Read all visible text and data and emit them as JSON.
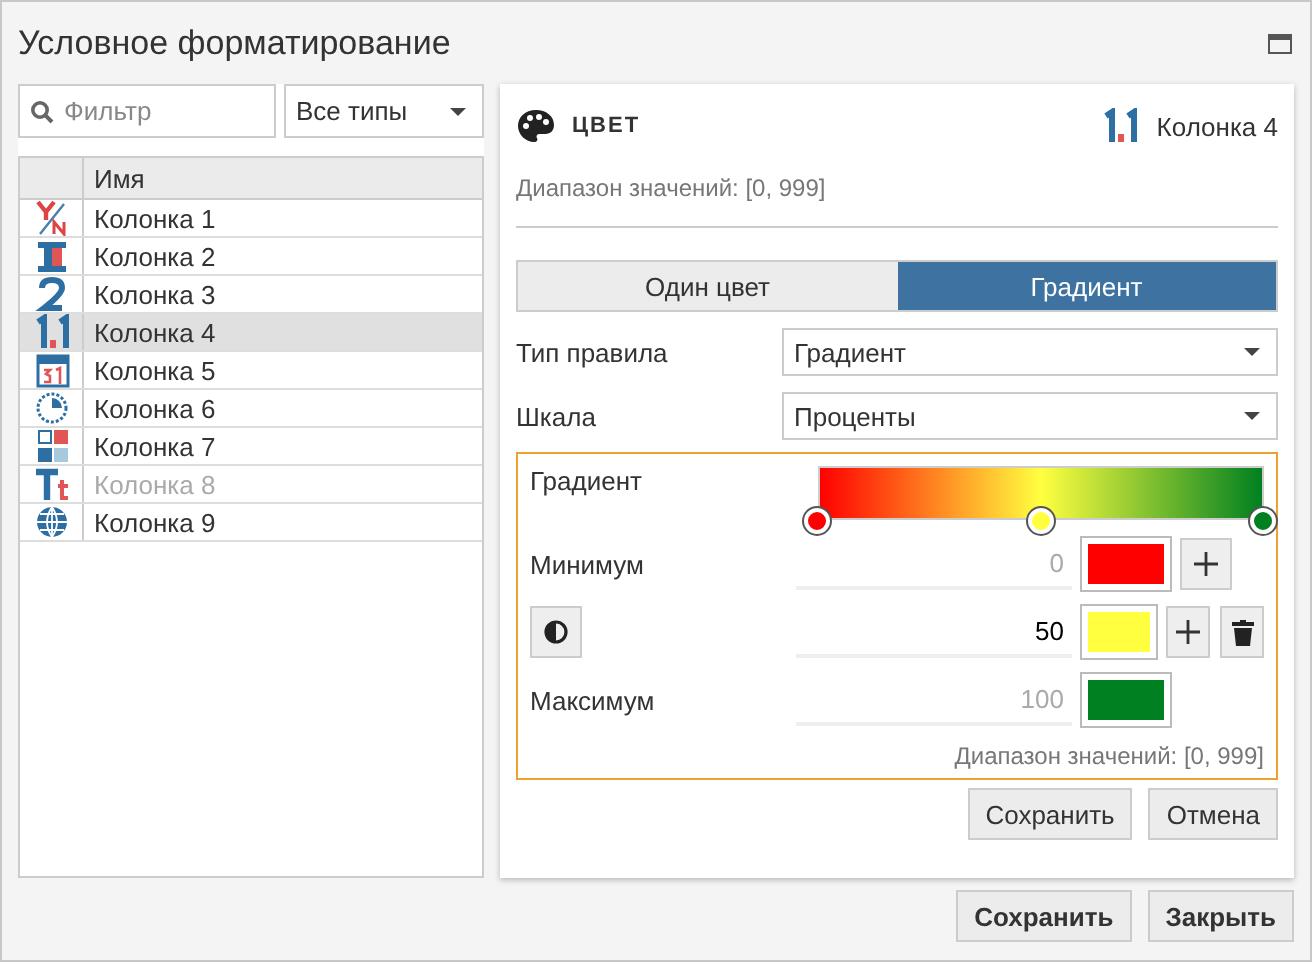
{
  "window": {
    "title": "Условное форматирование"
  },
  "filter": {
    "placeholder": "Фильтр"
  },
  "type_select": {
    "value": "Все типы"
  },
  "column_list": {
    "header": "Имя",
    "rows": [
      {
        "name": "Колонка 1",
        "kind": "boolean",
        "selected": false,
        "disabled": false
      },
      {
        "name": "Колонка 2",
        "kind": "block",
        "selected": false,
        "disabled": false
      },
      {
        "name": "Колонка 3",
        "kind": "integer",
        "selected": false,
        "disabled": false
      },
      {
        "name": "Колонка 4",
        "kind": "decimal",
        "selected": true,
        "disabled": false
      },
      {
        "name": "Колонка 5",
        "kind": "date",
        "selected": false,
        "disabled": false
      },
      {
        "name": "Колонка 6",
        "kind": "time",
        "selected": false,
        "disabled": false
      },
      {
        "name": "Колонка 7",
        "kind": "list",
        "selected": false,
        "disabled": false
      },
      {
        "name": "Колонка 8",
        "kind": "text",
        "selected": false,
        "disabled": true
      },
      {
        "name": "Колонка 9",
        "kind": "globe",
        "selected": false,
        "disabled": false
      }
    ]
  },
  "editor": {
    "section_title": "ЦВЕТ",
    "column": {
      "name": "Колонка 4",
      "kind": "decimal"
    },
    "range": "Диапазон значений: [0, 999]",
    "mode_tabs": [
      {
        "label": "Один цвет",
        "selected": false
      },
      {
        "label": "Градиент",
        "selected": true
      }
    ],
    "rule_type": {
      "label": "Тип правила",
      "value": "Градиент"
    },
    "scale": {
      "label": "Шкала",
      "value": "Проценты"
    },
    "gradient": {
      "label": "Градиент",
      "stops": [
        {
          "kind": "end",
          "label": "Минимум",
          "placeholder": "0",
          "color": "#ff0000",
          "level": 0,
          "can_add": true
        },
        {
          "kind": "middle",
          "value": "50",
          "color": "#ffff40",
          "level": 0.5,
          "can_add": true
        },
        {
          "kind": "end",
          "label": "Максимум",
          "placeholder": "100",
          "color": "#008020",
          "level": 1,
          "can_add": false
        }
      ],
      "range": "Диапазон значений: [0, 999]"
    },
    "buttons": [
      "Сохранить",
      "Отмена"
    ]
  },
  "footer_buttons": [
    "Сохранить",
    "Закрыть"
  ]
}
